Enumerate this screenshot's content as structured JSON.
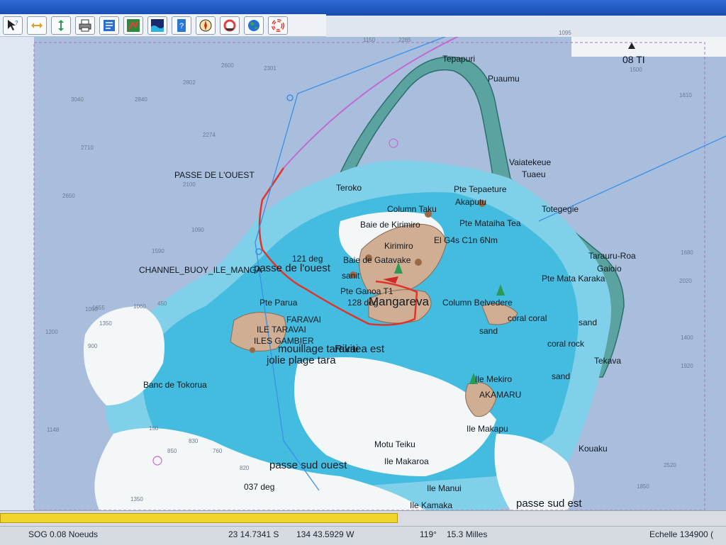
{
  "toolbar": {
    "buttons": [
      {
        "name": "help-cursor",
        "icon": "help-cursor-icon"
      },
      {
        "name": "zoom-horizontal",
        "icon": "horizontal-arrows-icon"
      },
      {
        "name": "zoom-vertical",
        "icon": "vertical-arrows-icon"
      },
      {
        "name": "print",
        "icon": "printer-icon"
      },
      {
        "name": "chart-properties",
        "icon": "list-icon"
      },
      {
        "name": "route",
        "icon": "route-icon"
      },
      {
        "name": "tide",
        "icon": "wave-icon"
      },
      {
        "name": "info",
        "icon": "info-icon"
      },
      {
        "name": "sailing",
        "icon": "compass-icon"
      },
      {
        "name": "navigation",
        "icon": "lifebuoy-ship-icon"
      },
      {
        "name": "globe",
        "icon": "globe-icon"
      },
      {
        "name": "lifebuoy",
        "icon": "lifebuoy-icon"
      }
    ]
  },
  "chart": {
    "labels": {
      "tepapuri": "Tepapuri",
      "puaumu": "Puaumu",
      "vaiatekeue": "Vaiatekeue",
      "tuaeu": "Tuaeu",
      "passe_de_louest_caps": "PASSE DE L'OUEST",
      "teroko": "Teroko",
      "pte_tepaeture": "Pte Tepaeture",
      "akaputu": "Akaputu",
      "totegegie": "Totegegie",
      "column_taku": "Column  Taku",
      "baie_kirimiro": "Baie de Kirimiro",
      "pte_mataiha": "Pte Mataiha  Tea",
      "el_gas": "El  G4s  C1n  6Nm",
      "kirimiro": "Kirimiro",
      "taraura_roa": "Tarauru-Roa",
      "gaioio": "Gaioio",
      "channel_buoy": "CHANNEL_BUOY_ILE_MANGA",
      "passe_de_louest": "passe de l'ouest",
      "deg121": "121  deg",
      "baie_gatavake": "Baie de Gatavake",
      "sanit": "sanit",
      "pte_mata_karaka": "Pte Mata Karaka",
      "pte_ganoa": "Pte Ganoa T1",
      "deg128": "128  deg",
      "mangareva": "Mangareva",
      "column_belvedere": "Column  Belvedere",
      "pte_parua": "Pte Parua",
      "ile_taravai": "ILE TARAVAI",
      "faravai": "FARAVAI",
      "sand": "sand",
      "sand2": "sand",
      "coral": "coral  coral",
      "coral_rock": "coral  rock",
      "ile_gambier": "ILES GAMBIER",
      "mouillage": "mouillage  taravai",
      "rikitea": "Rikitea  est",
      "jolie_plage": "jolie  plage  tara",
      "tekava": "Tekava",
      "ile_mekiro": "Ile Mekiro",
      "sand3": "sand",
      "akamaru": "AKAMARU",
      "banc_tokorua": "Banc de Tokorua",
      "ile_makapu": "Ile Makapu",
      "motu_teiku": "Motu Teiku",
      "ile_makaroa": "Ile Makaroa",
      "kouaku": "Kouaku",
      "passe_sud_ouest": "passe sud ouest",
      "deg037": "037 deg",
      "ile_manui": "Ile Manui",
      "ile_kamaka": "Ile Kamaka",
      "passe_sud_est": "passe sud est",
      "ti_08": "08 TI"
    },
    "depths": [
      "1150",
      "2285",
      "1095",
      "2600",
      "2301",
      "2802",
      "3040",
      "2840",
      "2274",
      "2710",
      "2100",
      "2650",
      "1090",
      "1500",
      "1610",
      "1590",
      "1680",
      "2020",
      "450",
      "1200",
      "1400",
      "1920",
      "1148",
      "1850",
      "1350",
      "2520",
      "1655",
      "1350",
      "900",
      "1060",
      "1050",
      "830",
      "760",
      "820",
      "850",
      "150"
    ],
    "colors": {
      "deep": "#a9bedd",
      "mid": "#7fd0e8",
      "shallow": "#43bce0",
      "sand": "#f4f7f8",
      "land": "#cfae93",
      "route": "#e0342a",
      "track": "#c06ad2",
      "bearing": "#3a8fe6",
      "chart_border": "#b46ec4"
    }
  },
  "progress": {
    "fraction": 0.548
  },
  "status": {
    "sog": "SOG 0.08 Noeuds",
    "lat": "23 14.7341 S",
    "lon": "134 43.5929 W",
    "bearing": "119°",
    "distance": "15.3 Milles",
    "scale": "Echelle 134900 ("
  }
}
